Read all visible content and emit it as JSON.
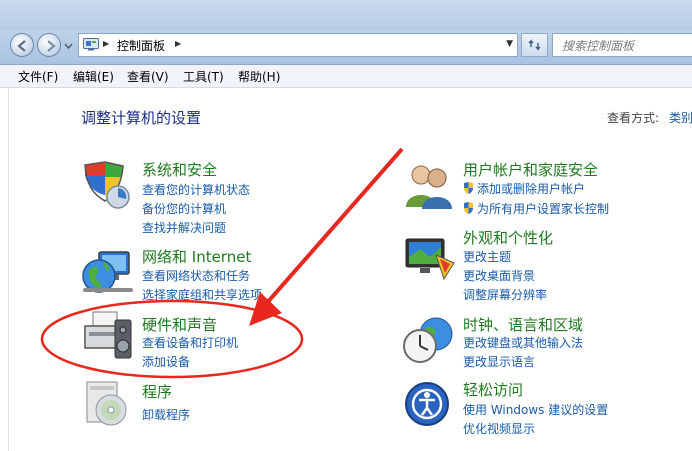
{
  "window": {
    "address": {
      "location": "控制面板"
    },
    "search": {
      "placeholder": "搜索控制面板"
    }
  },
  "menu": {
    "items": [
      "文件(F)",
      "编辑(E)",
      "查看(V)",
      "工具(T)",
      "帮助(H)"
    ]
  },
  "main": {
    "title": "调整计算机的设置",
    "view_by_label": "查看方式:",
    "view_by_value": "类别"
  },
  "categories": [
    {
      "title": "系统和安全",
      "icon": "system-security-icon",
      "links": [
        "查看您的计算机状态",
        "备份您的计算机",
        "查找并解决问题"
      ]
    },
    {
      "title": "网络和 Internet",
      "icon": "network-globe-icon",
      "links": [
        "查看网络状态和任务",
        "选择家庭组和共享选项"
      ]
    },
    {
      "title": "硬件和声音",
      "icon": "printer-speaker-icon",
      "links": [
        "查看设备和打印机",
        "添加设备"
      ]
    },
    {
      "title": "程序",
      "icon": "programs-disc-icon",
      "links": [
        "卸载程序"
      ]
    },
    {
      "title": "用户帐户和家庭安全",
      "icon": "users-icon",
      "links": [
        "添加或删除用户帐户",
        "为所有用户设置家长控制"
      ]
    },
    {
      "title": "外观和个性化",
      "icon": "monitor-palette-icon",
      "links": [
        "更改主题",
        "更改桌面背景",
        "调整屏幕分辨率"
      ]
    },
    {
      "title": "时钟、语言和区域",
      "icon": "clock-globe-icon",
      "links": [
        "更改键盘或其他输入法",
        "更改显示语言"
      ]
    },
    {
      "title": "轻松访问",
      "icon": "ease-of-access-icon",
      "links": [
        "使用 Windows 建议的设置",
        "优化视频显示"
      ]
    }
  ],
  "colors": {
    "category_title": "#1f7a1f",
    "link": "#1a5ba8",
    "annotation": "#e8271f"
  }
}
